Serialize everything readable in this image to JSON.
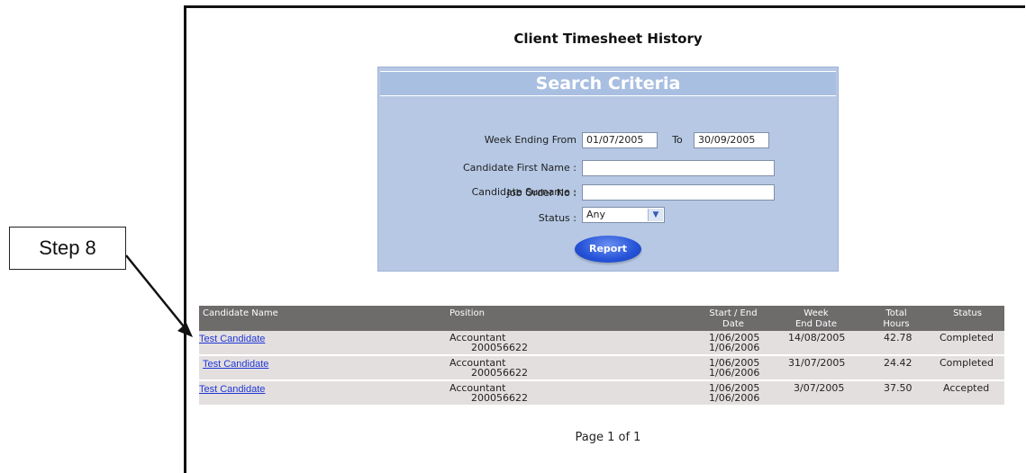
{
  "callout": {
    "label": "Step 8"
  },
  "page": {
    "title": "Client Timesheet History"
  },
  "search": {
    "header": "Search Criteria",
    "week_ending_from_label": "Week Ending From",
    "week_from_value": "01/07/2005",
    "to_label": "To",
    "week_to_value": "30/09/2005",
    "first_name_label": "Candidate First Name :",
    "first_name_value": "",
    "surname_label": "Candidate Surname :",
    "surname_value": "",
    "job_order_label": "Job Order No :",
    "job_order_value": "",
    "status_label": "Status :",
    "status_value": "Any",
    "report_button": "Report"
  },
  "table": {
    "headers": {
      "candidate_name": "Candidate Name",
      "position": "Position",
      "start_end_1": "Start / End",
      "start_end_2": "Date",
      "week_end_1": "Week",
      "week_end_2": "End Date",
      "total_1": "Total",
      "total_2": "Hours",
      "status": "Status"
    },
    "rows": [
      {
        "name": "Test Candidate",
        "position": "Accountant",
        "job_no": "200056622",
        "start": "1/06/2005",
        "end": "1/06/2006",
        "week_end": "14/08/2005",
        "hours": "42.78",
        "status": "Completed"
      },
      {
        "name": "Test Candidate",
        "position": "Accountant",
        "job_no": "200056622",
        "start": "1/06/2005",
        "end": "1/06/2006",
        "week_end": "31/07/2005",
        "hours": "24.42",
        "status": "Completed"
      },
      {
        "name": "Test Candidate",
        "position": "Accountant",
        "job_no": "200056622",
        "start": "1/06/2005",
        "end": "1/06/2006",
        "week_end": "3/07/2005",
        "hours": "37.50",
        "status": "Accepted"
      }
    ]
  },
  "pagination": {
    "text": "Page 1 of 1"
  }
}
